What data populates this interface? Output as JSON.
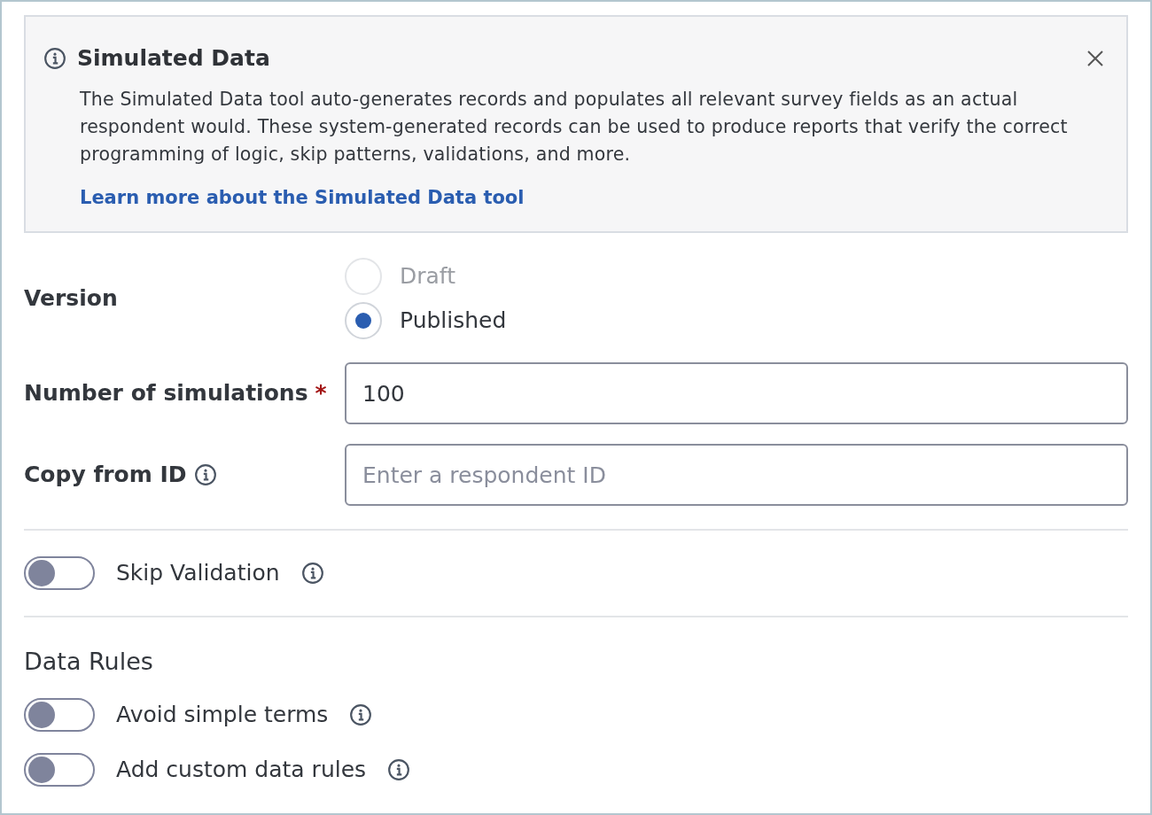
{
  "banner": {
    "title": "Simulated Data",
    "body": "The Simulated Data tool auto-generates records and populates all relevant survey fields as an actual respondent would. These system-generated records can be used to produce reports that verify the correct programming of logic, skip patterns, validations, and more.",
    "link": "Learn more about the Simulated Data tool"
  },
  "version": {
    "label": "Version",
    "options": [
      {
        "label": "Draft",
        "selected": false,
        "disabled": true
      },
      {
        "label": "Published",
        "selected": true,
        "disabled": false
      }
    ]
  },
  "fields": [
    {
      "label": "Number of simulations",
      "required_mark": "*",
      "info": false,
      "value": "100"
    },
    {
      "label": "Copy from ID",
      "info": true,
      "placeholder": "Enter a respondent ID"
    }
  ],
  "skip_toggle": {
    "label": "Skip Validation",
    "on": false,
    "info": true
  },
  "data_rules": {
    "heading": "Data Rules",
    "toggles": [
      {
        "label": "Avoid simple terms",
        "on": false,
        "info": true
      },
      {
        "label": "Add custom data rules",
        "on": false,
        "info": true
      }
    ]
  }
}
